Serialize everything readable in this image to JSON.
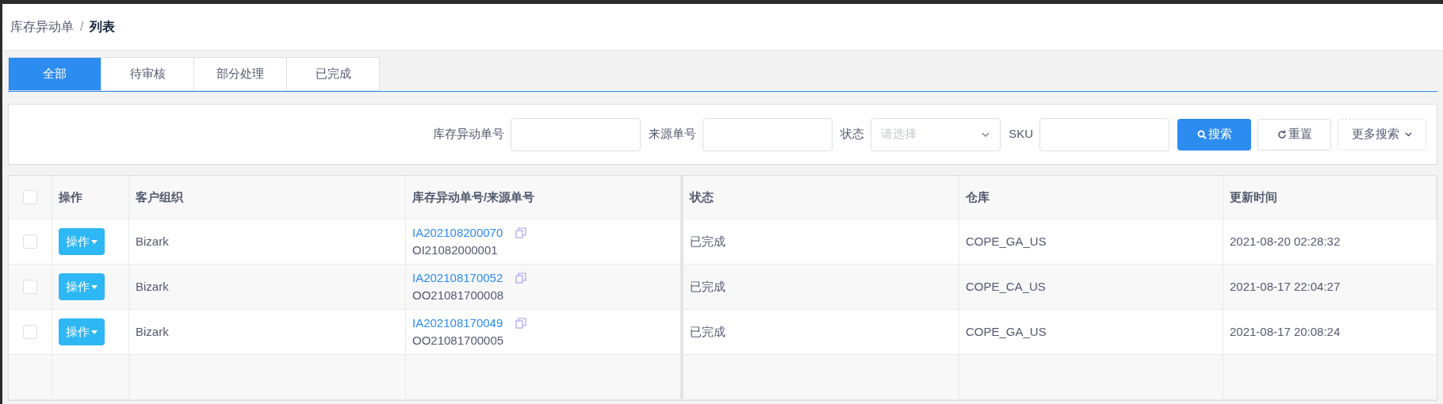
{
  "breadcrumb": [
    {
      "text": "库存异动单",
      "current": false
    },
    {
      "text": "列表",
      "current": true
    }
  ],
  "breadcrumb_separator": "/",
  "tabs": [
    {
      "label": "全部",
      "selected": true
    },
    {
      "label": "待审核",
      "selected": false
    },
    {
      "label": "部分处理",
      "selected": false
    },
    {
      "label": "已完成",
      "selected": false
    }
  ],
  "filters": [
    {
      "kind": "text",
      "label": "库存异动单号"
    },
    {
      "kind": "text",
      "label": "来源单号"
    },
    {
      "kind": "select",
      "label": "状态",
      "placeholder": "请选择"
    },
    {
      "kind": "text",
      "label": "SKU"
    }
  ],
  "filter_buttons": [
    {
      "kind": "primary",
      "label": "搜索"
    },
    {
      "kind": "reset",
      "label": "重置"
    },
    {
      "kind": "more",
      "label": "更多搜索"
    }
  ],
  "table": {
    "select_all_checked": false,
    "columns": [
      "操作",
      "客户组织",
      "库存异动单号/来源单号",
      "状态",
      "仓库",
      "更新时间"
    ],
    "rows": [
      {
        "checked": false,
        "action": "操作",
        "org": "Bizark",
        "adjust_no": "IA202108200070",
        "source_no": "OI21082000001",
        "status": "已完成",
        "warehouse": "COPE_GA_US",
        "updated": "2021-08-20 02:28:32"
      },
      {
        "checked": false,
        "action": "操作",
        "org": "Bizark",
        "adjust_no": "IA202108170052",
        "source_no": "OO21081700008",
        "status": "已完成",
        "warehouse": "COPE_CA_US",
        "updated": "2021-08-17 22:04:27"
      },
      {
        "checked": false,
        "action": "操作",
        "org": "Bizark",
        "adjust_no": "IA202108170049",
        "source_no": "OO21081700005",
        "status": "已完成",
        "warehouse": "COPE_GA_US",
        "updated": "2021-08-17 20:08:24"
      }
    ]
  }
}
